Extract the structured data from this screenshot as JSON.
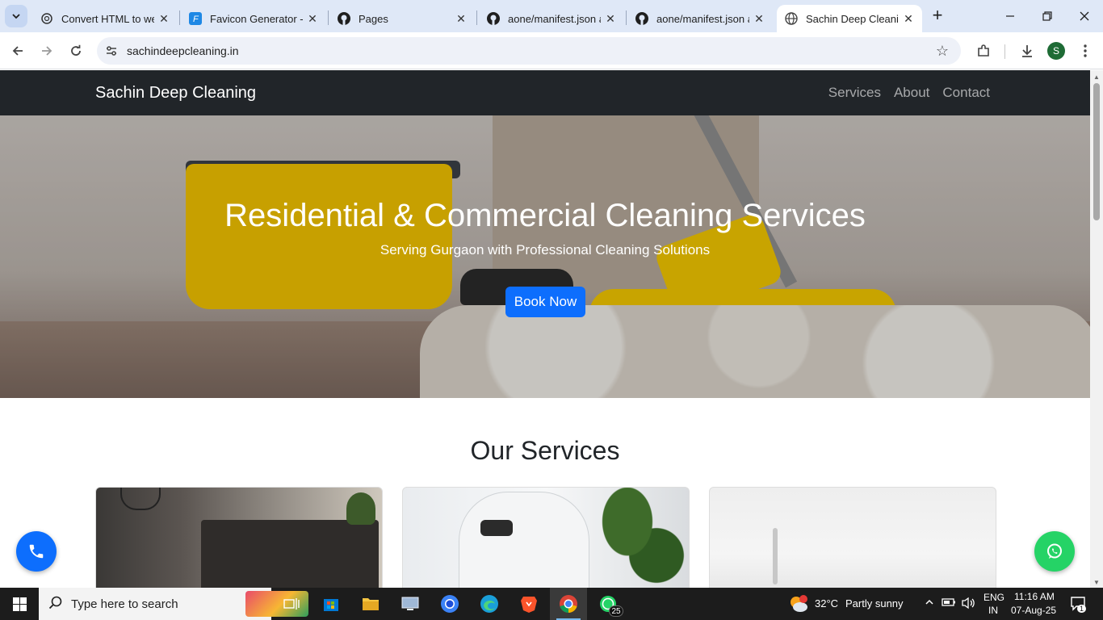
{
  "browser": {
    "tabs": [
      {
        "title": "Convert HTML to web",
        "icon": "chatgpt-icon",
        "active": false
      },
      {
        "title": "Favicon Generator - T",
        "icon": "favicon-generator-icon",
        "active": false
      },
      {
        "title": "Pages",
        "icon": "github-icon",
        "active": false
      },
      {
        "title": "aone/manifest.json at",
        "icon": "github-icon",
        "active": false
      },
      {
        "title": "aone/manifest.json at",
        "icon": "github-icon",
        "active": false
      },
      {
        "title": "Sachin Deep Cleaning",
        "icon": "globe-icon",
        "active": true
      }
    ],
    "url": "sachindeepcleaning.in",
    "profile_initial": "S"
  },
  "site": {
    "brand": "Sachin Deep Cleaning",
    "nav": [
      "Services",
      "About",
      "Contact"
    ],
    "hero": {
      "title": "Residential & Commercial Cleaning Services",
      "subtitle": "Serving Gurgaon with Professional Cleaning Solutions",
      "cta": "Book Now"
    },
    "services_title": "Our Services",
    "accent_color": "#0d6efd",
    "nav_bg": "#212529",
    "whatsapp_color": "#25d366"
  },
  "taskbar": {
    "search_placeholder": "Type here to search",
    "whatsapp_badge": "25",
    "weather": {
      "temp": "32°C",
      "condition": "Partly sunny"
    },
    "lang": {
      "line1": "ENG",
      "line2": "IN"
    },
    "time": "11:16 AM",
    "date": "07-Aug-25",
    "notification_count": "1"
  }
}
